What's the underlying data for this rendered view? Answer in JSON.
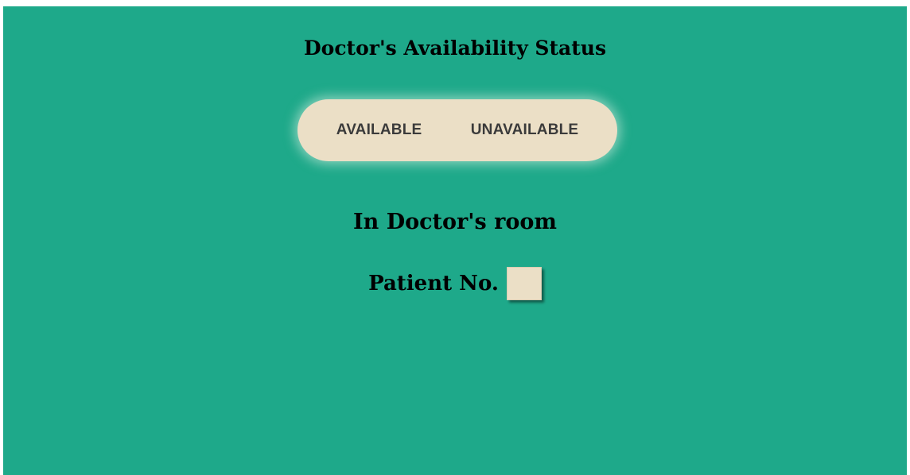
{
  "page": {
    "title": "Doctor's Availability Status",
    "background_color": "#1ea98a",
    "panel_color": "#ebdfc6"
  },
  "status_toggle": {
    "available_label": "AVAILABLE",
    "unavailable_label": "UNAVAILABLE"
  },
  "room": {
    "heading": "In Doctor's room",
    "patient_label": "Patient No.",
    "patient_value": ""
  }
}
